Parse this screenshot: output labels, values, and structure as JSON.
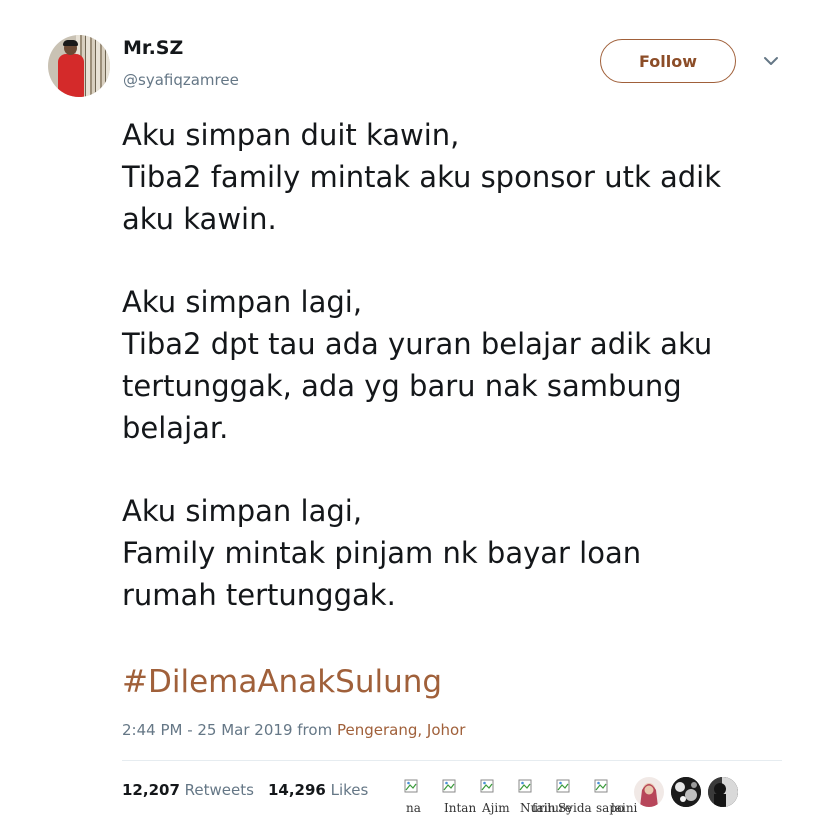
{
  "author": {
    "name": "Mr.SZ",
    "handle": "@syafiqzamree"
  },
  "follow_label": "Follow",
  "tweet_lines": [
    "Aku simpan duit kawin,",
    "Tiba2 family mintak aku sponsor utk adik",
    "aku kawin.",
    "",
    "Aku simpan lagi,",
    "Tiba2 dpt tau ada yuran belajar adik aku",
    "tertunggak, ada yg baru nak sambung",
    "belajar.",
    "",
    "Aku simpan lagi,",
    "Family mintak pinjam nk bayar loan",
    "rumah tertunggak."
  ],
  "hashtag": "#DilemaAnakSulung",
  "meta": {
    "time": "2:44 PM - 25 Mar 2019",
    "from_label": "from",
    "location": "Pengerang, Johor"
  },
  "stats": {
    "retweets_count": "12,207",
    "retweets_label": "Retweets",
    "likes_count": "14,296",
    "likes_label": "Likes"
  },
  "likers": [
    "na",
    "Intan",
    "Ajim",
    "Nurin",
    "failure",
    "Syida",
    "sapo",
    "laini"
  ],
  "colors": {
    "accent": "#a0603a",
    "muted": "#657786",
    "text": "#14171a"
  },
  "icons": {
    "more": "chevron-down-icon",
    "broken_image": "broken-image-icon"
  }
}
